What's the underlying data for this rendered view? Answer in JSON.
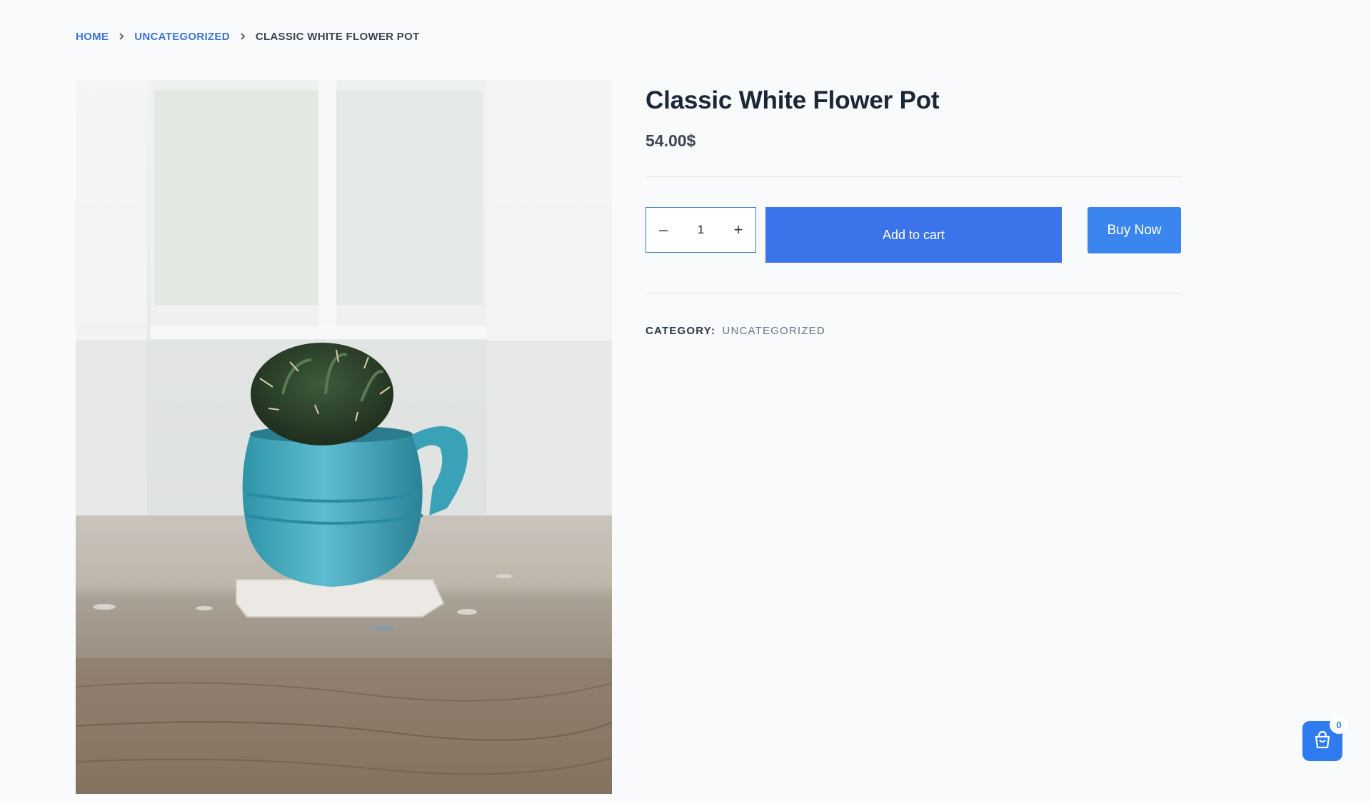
{
  "breadcrumb": {
    "home": "HOME",
    "category": "UNCATEGORIZED",
    "current": "CLASSIC WHITE FLOWER POT"
  },
  "product": {
    "image_alt": "Cactus in a turquoise cup pot on a wooden table",
    "title": "Classic White Flower Pot",
    "price": "54.00$",
    "quantity": "1",
    "decrease_symbol": "–",
    "increase_symbol": "+",
    "add_to_cart_label": "Add to cart",
    "buy_now_label": "Buy Now",
    "category_label": "CATEGORY:",
    "category_value": "UNCATEGORIZED"
  },
  "floating_cart": {
    "count": "0",
    "icon": "shopping-bag-icon"
  },
  "colors": {
    "accent": "#3b74ea",
    "buy_now": "#3a86ee",
    "link": "#3b74d6",
    "background": "#f8fafb"
  }
}
